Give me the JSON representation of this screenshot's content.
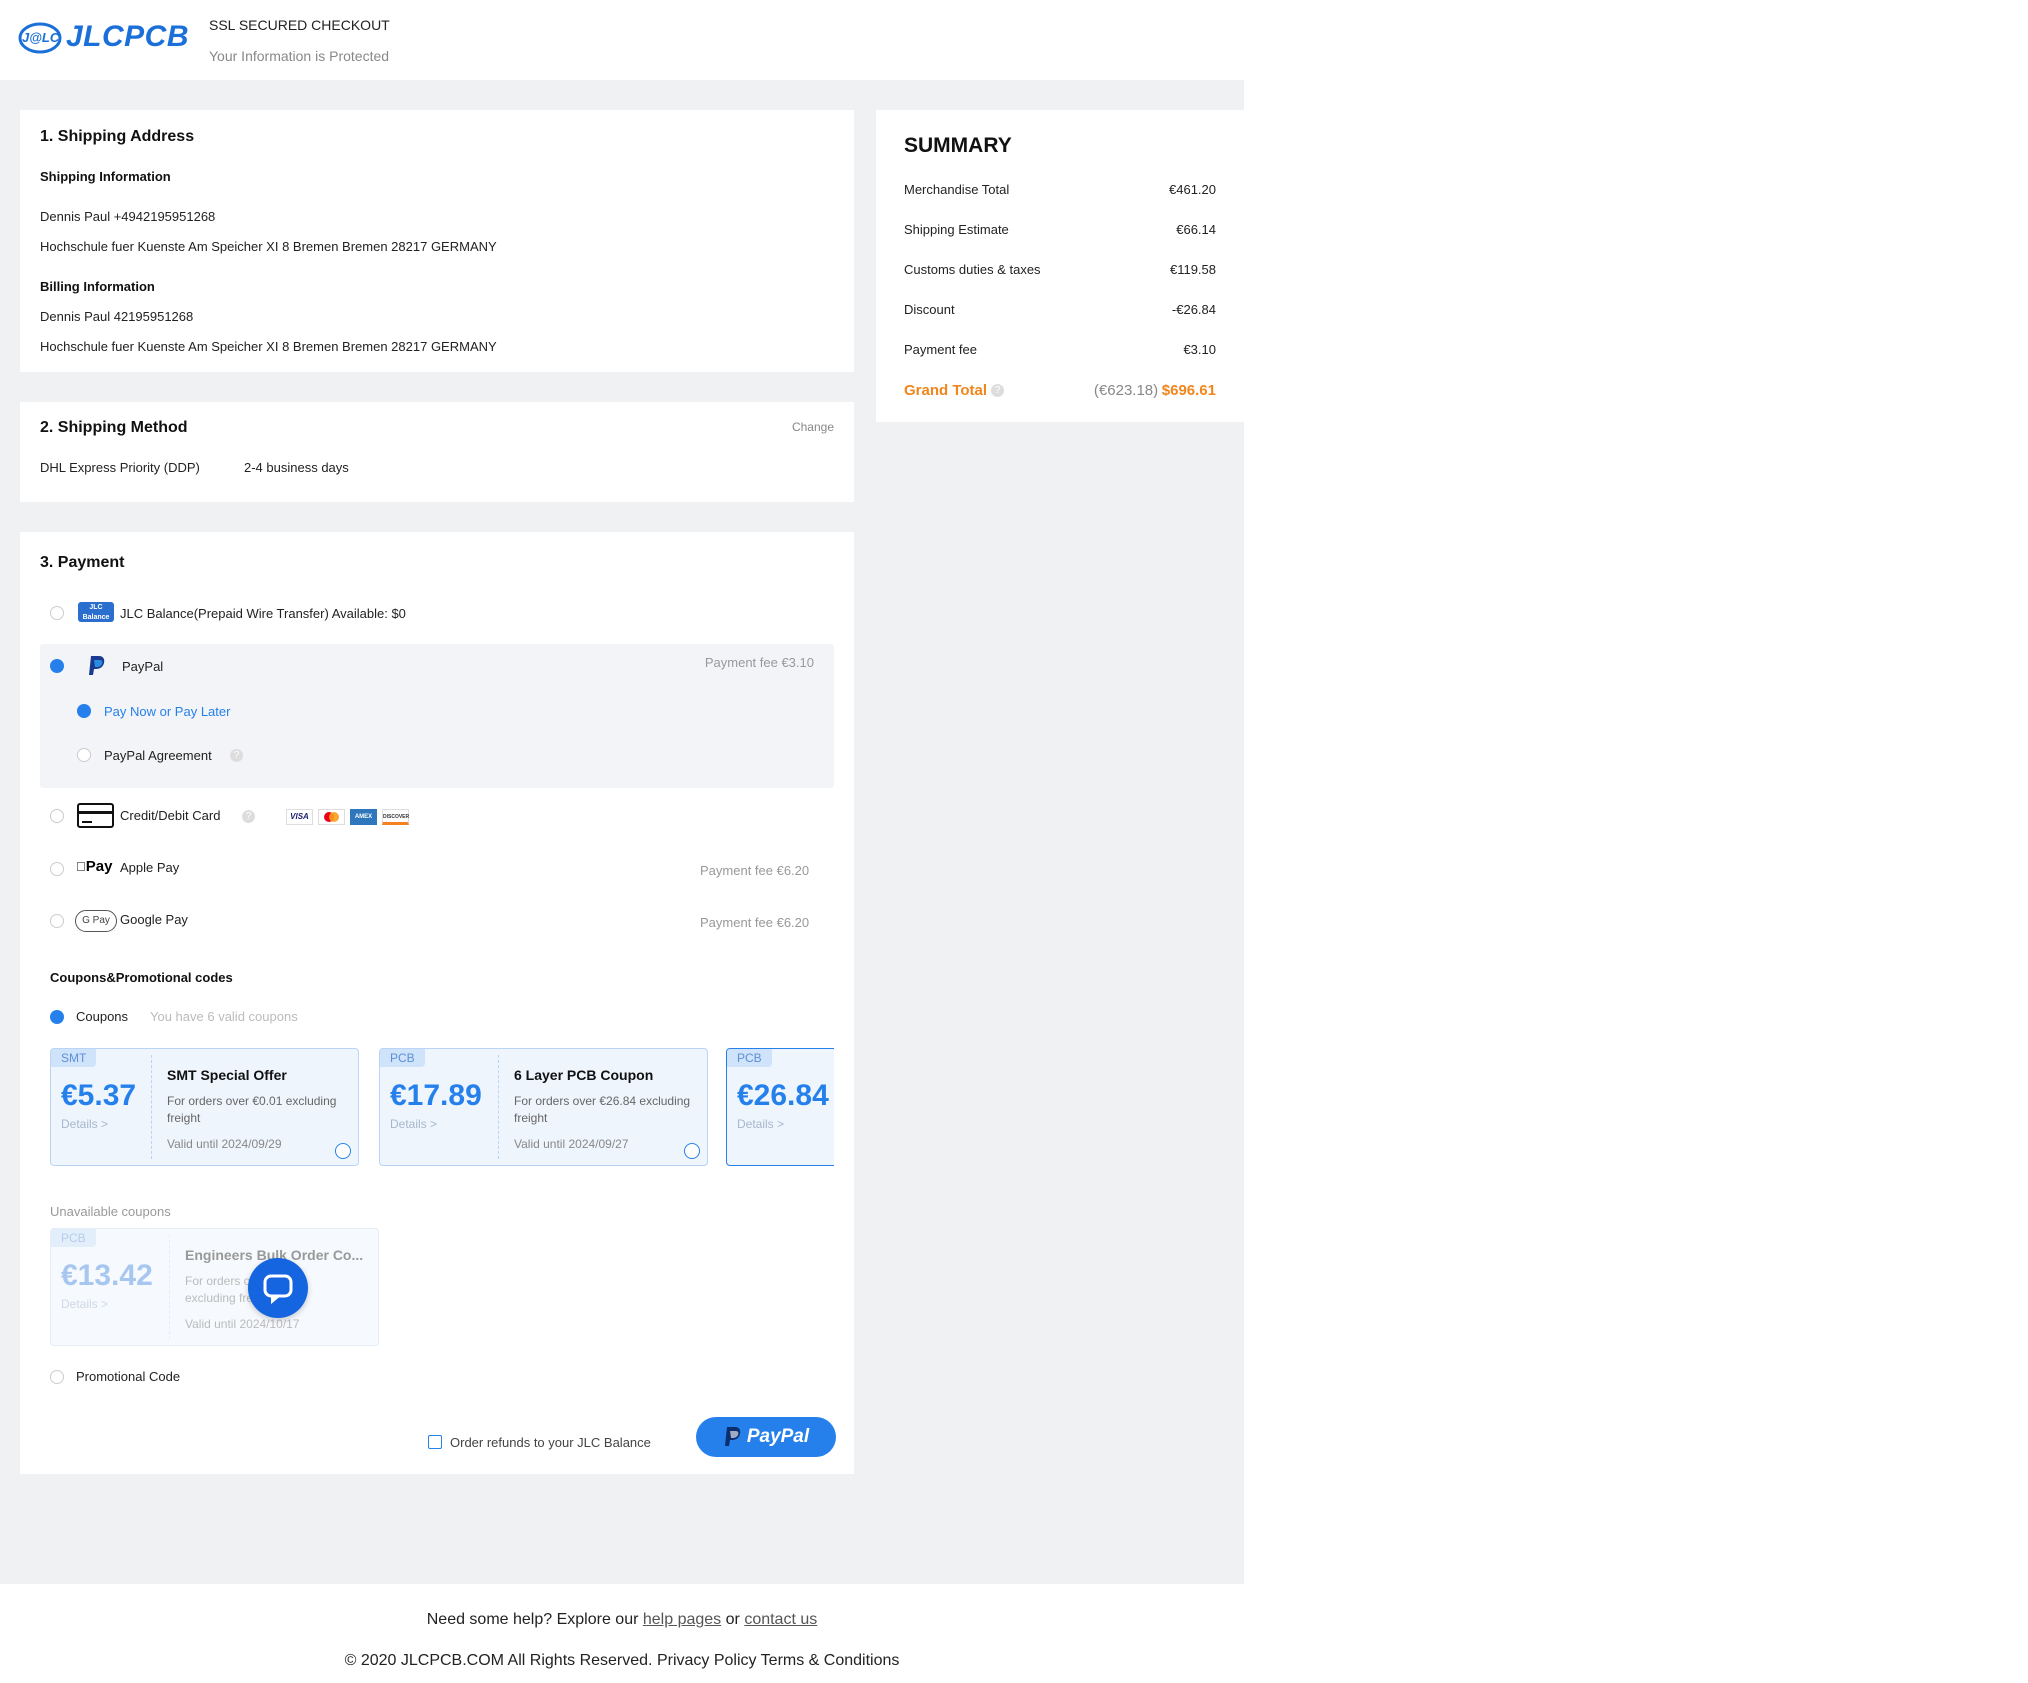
{
  "header": {
    "logo_text": "JLCPCB",
    "logo_mark": "J@LC",
    "ssl_title": "SSL SECURED CHECKOUT",
    "ssl_subtitle": "Your Information is Protected"
  },
  "shipping_address": {
    "title": "1. Shipping Address",
    "shipping_info_label": "Shipping Information",
    "shipping_name_phone": "Dennis Paul +4942195951268",
    "shipping_address": "Hochschule fuer Kuenste Am Speicher XI 8 Bremen Bremen 28217 GERMANY",
    "billing_info_label": "Billing Information",
    "billing_name_phone": "Dennis Paul 42195951268",
    "billing_address": "Hochschule fuer Kuenste Am Speicher XI 8 Bremen Bremen 28217 GERMANY"
  },
  "shipping_method": {
    "title": "2. Shipping Method",
    "change_label": "Change",
    "method": "DHL Express Priority (DDP)",
    "duration": "2-4 business days"
  },
  "payment": {
    "title": "3. Payment",
    "options": {
      "jlc_balance": {
        "label": "JLC Balance(Prepaid Wire Transfer) Available: $0",
        "icon_text": "JLC Balance"
      },
      "paypal": {
        "label": "PayPal",
        "fee": "Payment fee €3.10",
        "sub_pay_now": "Pay Now or Pay Later",
        "sub_agreement": "PayPal Agreement"
      },
      "card": {
        "label": "Credit/Debit Card",
        "brands": [
          "VISA",
          "MC",
          "AMEX",
          "DISCOVER"
        ]
      },
      "apple_pay": {
        "label": "Apple Pay",
        "icon_text": "Pay",
        "fee": "Payment fee €6.20"
      },
      "google_pay": {
        "label": "Google Pay",
        "icon_text": "G Pay",
        "fee": "Payment fee €6.20"
      }
    },
    "coupons_section_title": "Coupons&Promotional codes",
    "coupons_label": "Coupons",
    "coupons_hint": "You have 6 valid coupons",
    "coupons": [
      {
        "tag": "SMT",
        "amount": "€5.37",
        "details": "Details >",
        "title": "SMT Special Offer",
        "desc": "For orders over €0.01 excluding freight",
        "valid": "Valid until 2024/09/29"
      },
      {
        "tag": "PCB",
        "amount": "€17.89",
        "details": "Details >",
        "title": "6 Layer PCB Coupon",
        "desc": "For orders over €26.84 excluding freight",
        "valid": "Valid until 2024/09/27"
      },
      {
        "tag": "PCB",
        "amount": "€26.84",
        "details": "Details >"
      }
    ],
    "unavailable_label": "Unavailable coupons",
    "unavailable_coupon": {
      "tag": "PCB",
      "amount": "€13.42",
      "details": "Details >",
      "title": "Engineers Bulk Order Co...",
      "desc_line1": "For orders over €26.8",
      "desc_line2": "excluding freight",
      "valid": "Valid until 2024/10/17"
    },
    "promo_label": "Promotional Code",
    "refund_label": "Order refunds to your JLC Balance",
    "paypal_button_label": "PayPal"
  },
  "summary": {
    "title": "SUMMARY",
    "rows": [
      {
        "label": "Merchandise Total",
        "value": "€461.20"
      },
      {
        "label": "Shipping Estimate",
        "value": "€66.14"
      },
      {
        "label": "Customs duties & taxes",
        "value": "€119.58"
      },
      {
        "label": "Discount",
        "value": "-€26.84"
      },
      {
        "label": "Payment fee",
        "value": "€3.10"
      }
    ],
    "grand_total_label": "Grand Total",
    "grand_total_alt": "(€623.18)",
    "grand_total_value": "$696.61",
    "accent_color": "#f0861c"
  },
  "footer": {
    "help_prefix": "Need some help? Explore our",
    "help_link": "help pages",
    "help_or": "or",
    "contact_link": "contact us",
    "copyright": "© 2020 JLCPCB.COM All Rights Reserved. Privacy Policy Terms & Conditions"
  }
}
